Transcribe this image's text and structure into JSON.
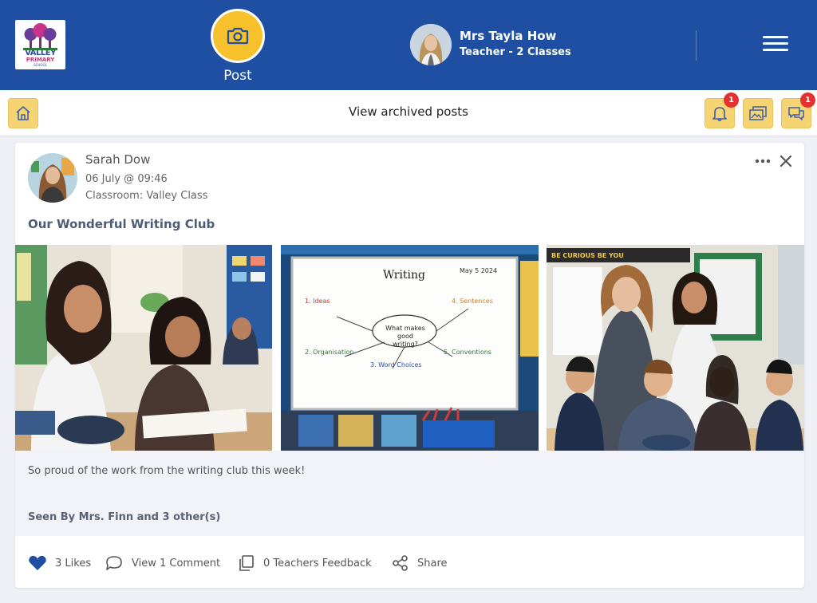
{
  "header": {
    "logo": {
      "line1": "VALLEY",
      "line2": "PRIMARY",
      "line3": "SCHOOL"
    },
    "post_label": "Post",
    "user_name": "Mrs Tayla How",
    "user_role": "Teacher - 2 Classes"
  },
  "subbar": {
    "archived_label": "View archived posts",
    "notifications_badge": "1",
    "messages_badge": "1"
  },
  "post": {
    "author": "Sarah Dow",
    "date": "06 July @ 09:46",
    "classroom": "Classroom: Valley Class",
    "title": "Our Wonderful Writing Club",
    "body": "So proud of the work from the writing club this week!",
    "seen_by": "Seen By Mrs. Finn and 3 other(s)",
    "photos": {
      "whiteboard": {
        "heading": "Writing",
        "date": "May 5 2024",
        "center": "What makes good writing?",
        "ideas": "1. Ideas",
        "sentences": "4. Sentences",
        "organisation": "2. Organisation",
        "word_choices": "3. Word Choices",
        "conventions": "5. Conventions"
      },
      "banner": "BE CURIOUS  BE YOU"
    },
    "actions": {
      "likes": "3 Likes",
      "comments": "View 1 Comment",
      "feedback": "0 Teachers Feedback",
      "share": "Share"
    }
  },
  "colors": {
    "header_bg": "#1e4fa3",
    "accent_yellow": "#f6c12a",
    "badge_red": "#e3312f",
    "like_blue": "#1e4fa3"
  },
  "icons": [
    "camera-icon",
    "menu-icon",
    "home-icon",
    "bell-icon",
    "gallery-icon",
    "chat-icon",
    "more-icon",
    "close-icon",
    "heart-icon",
    "comment-icon",
    "copy-icon",
    "share-icon"
  ]
}
